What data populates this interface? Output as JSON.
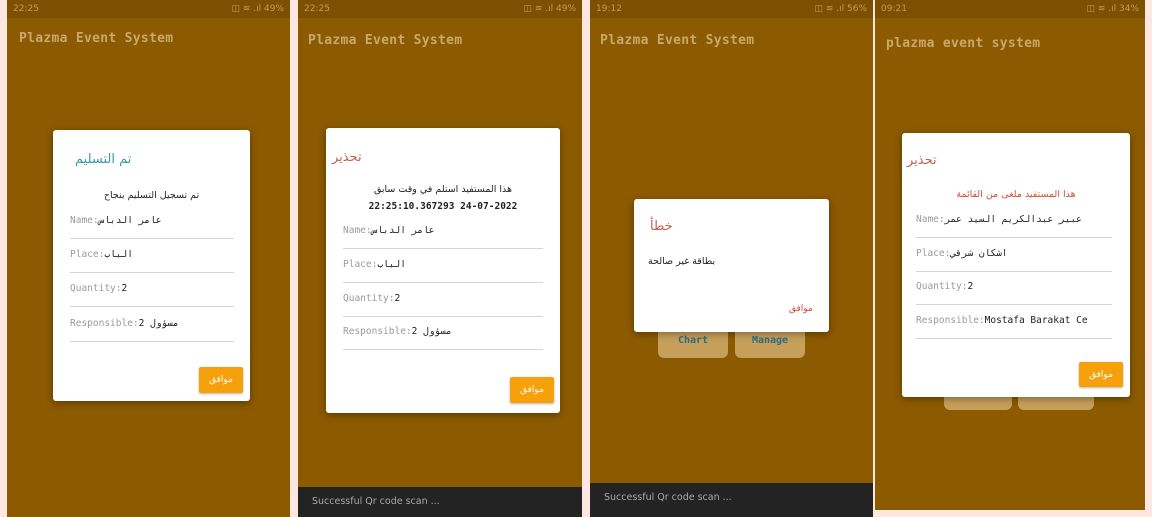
{
  "screens": [
    {
      "status_time": "22:25",
      "status_icons": "◫ ≋ .ıl 49%",
      "app_title": "Plazma Event System",
      "dialog": {
        "title": "تم التسليم",
        "message": "تم تسجيل التسليم بنجاح",
        "name_label": "Name:",
        "name_value": "عامر الدباس",
        "place_label": "Place:",
        "place_value": "الباب",
        "quantity_label": "Quantity:",
        "quantity_value": "2",
        "responsible_label": "Responsible:",
        "responsible_value": "مسؤول 2",
        "ok_label": "موافق"
      }
    },
    {
      "status_time": "22:25",
      "status_icons": "◫ ≋ .ıl 49%",
      "app_title": "Plazma Event System",
      "dialog": {
        "title": "تحذير",
        "message_line1": "هذا المستفيد استلم في وقت سابق",
        "message_line2": "22:25:10.367293 24-07-2022",
        "name_label": "Name:",
        "name_value": "عامر الدباس",
        "place_label": "Place:",
        "place_value": "الباب",
        "quantity_label": "Quantity:",
        "quantity_value": "2",
        "responsible_label": "Responsible:",
        "responsible_value": "مسؤول 2",
        "ok_label": "موافق"
      },
      "snackbar": "Successful Qr code scan ..."
    },
    {
      "status_time": "19:12",
      "status_icons": "◫ ≋ .ıl 56%",
      "app_title": "Plazma Event System",
      "dialog": {
        "title": "خطأ",
        "message": "بطاقة غير صالحة",
        "ok_label": "موافق"
      },
      "chart_button": "Chart",
      "manage_button": "Manage",
      "snackbar": "Successful Qr code scan ..."
    },
    {
      "status_time": "09:21",
      "status_icons": "◫ ≋ .ıl 34%",
      "app_title": "plazma event system",
      "dialog": {
        "title": "تحذير",
        "message": "هذا المستفيد ملغى من القائمة",
        "name_label": "Name:",
        "name_value": "عبير عبدالكريم السيد عمر",
        "place_label": "Place:",
        "place_value": "اشكان شرقي",
        "quantity_label": "Quantity:",
        "quantity_value": "2",
        "responsible_label": "Responsible:",
        "responsible_value": "Mostafa Barakat Ce",
        "ok_label": "موافق"
      }
    }
  ]
}
